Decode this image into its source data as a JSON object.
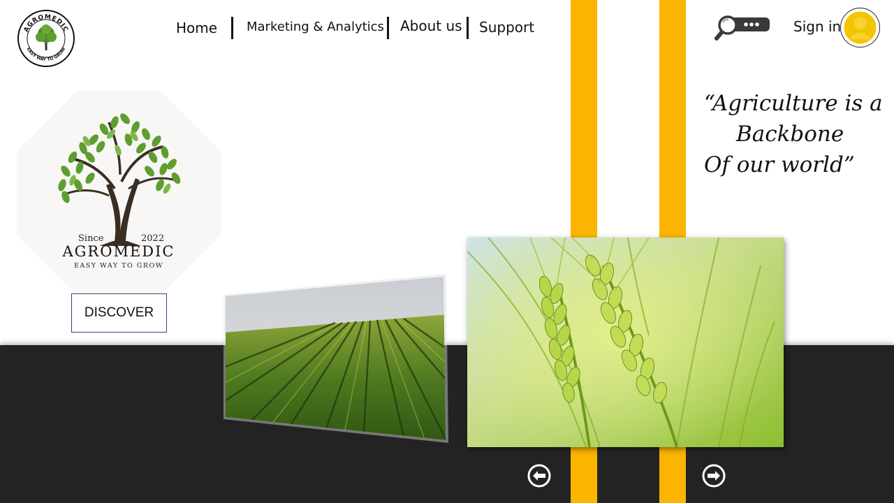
{
  "header": {
    "logo": {
      "ring_text": "AGROMEDIC",
      "tagline": "EASY WAY TO GROW",
      "icon": "tree-logo-icon"
    },
    "nav": {
      "home": "Home",
      "marketing": "Marketing & Analytics",
      "about": "About us",
      "support": "Support"
    },
    "search_icon": "search-icon",
    "signin_label": "Sign in",
    "avatar_icon": "user-avatar-icon"
  },
  "hero": {
    "brand": {
      "since": "Since",
      "year": "2022",
      "name": "AGROMEDIC",
      "tagline": "EASY WAY TO GROW"
    },
    "discover_label": "DISCOVER",
    "quote": {
      "line1": "“Agriculture is a",
      "line2": "Backbone",
      "line3": "Of our world”"
    }
  },
  "gallery": {
    "images": [
      "crop-field-rows",
      "wheat-ears-closeup"
    ],
    "prev_icon": "arrow-left-circle-icon",
    "next_icon": "arrow-right-circle-icon"
  },
  "colors": {
    "accent_stripe": "#FBB500",
    "dark_band": "#232323",
    "avatar_yellow": "#F5C400",
    "leaf_green": "#5E9E2F",
    "trunk_brown": "#3A2E22"
  }
}
